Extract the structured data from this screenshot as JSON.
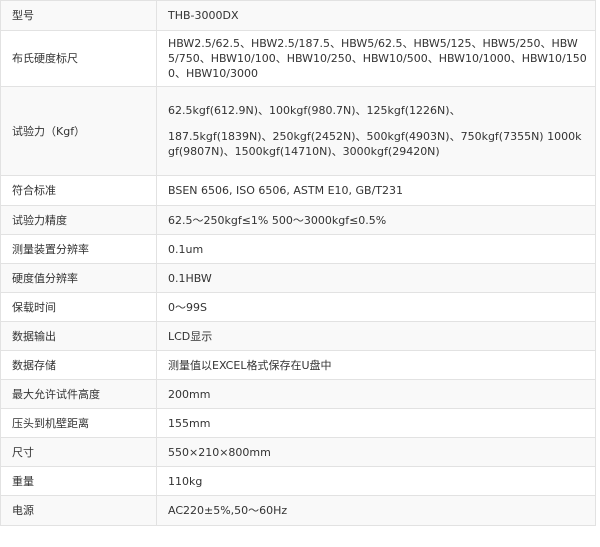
{
  "rows": [
    {
      "label": "型号",
      "value": [
        "THB-3000DX"
      ]
    },
    {
      "label": "布氏硬度标尺",
      "value": [
        "HBW2.5/62.5、HBW2.5/187.5、HBW5/62.5、HBW5/125、HBW5/250、HBW5/750、HBW10/100、HBW10/250、HBW10/500、HBW10/1000、HBW10/1500、HBW10/3000"
      ]
    },
    {
      "label": "试验力（Kgf）",
      "value": [
        "62.5kgf(612.9N)、100kgf(980.7N)、125kgf(1226N)、",
        "187.5kgf(1839N)、250kgf(2452N)、500kgf(4903N)、750kgf(7355N) 1000kgf(9807N)、1500kgf(14710N)、3000kgf(29420N)"
      ]
    },
    {
      "label": "符合标准",
      "value": [
        "BSEN 6506, ISO 6506, ASTM E10, GB/T231"
      ]
    },
    {
      "label": "试验力精度",
      "value": [
        "62.5～250kgf≤1%   500～3000kgf≤0.5%"
      ]
    },
    {
      "label": "测量装置分辨率",
      "value": [
        "0.1um"
      ]
    },
    {
      "label": "硬度值分辨率",
      "value": [
        "0.1HBW"
      ]
    },
    {
      "label": "保载时间",
      "value": [
        "0～99S"
      ]
    },
    {
      "label": "数据输出",
      "value": [
        "LCD显示"
      ]
    },
    {
      "label": "数据存储",
      "value": [
        "测量值以EXCEL格式保存在U盘中"
      ]
    },
    {
      "label": "最大允许试件高度",
      "value": [
        "200mm"
      ]
    },
    {
      "label": "压头到机壁距离",
      "value": [
        "155mm"
      ]
    },
    {
      "label": "尺寸",
      "value": [
        "550×210×800mm"
      ]
    },
    {
      "label": "重量",
      "value": [
        "110kg"
      ]
    },
    {
      "label": "电源",
      "value": [
        "AC220±5%,50～60Hz"
      ]
    }
  ]
}
